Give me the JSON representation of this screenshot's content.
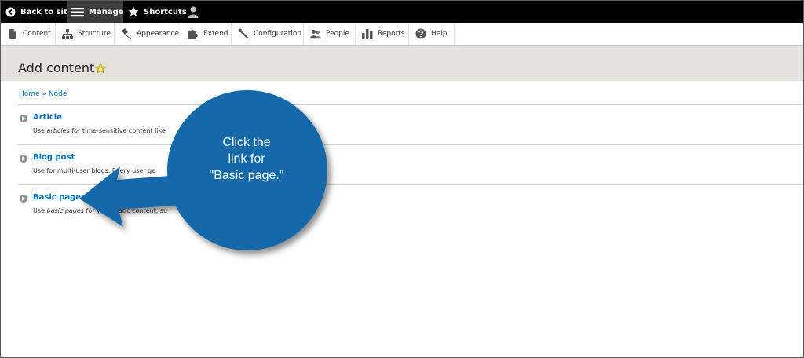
{
  "admin_bar": {
    "back_label": "Back to site",
    "manage_label": "Manage",
    "shortcuts_label": "Shortcuts",
    "user_label": ""
  },
  "toolbar": {
    "items": [
      {
        "label": "Content",
        "icon": "document-icon"
      },
      {
        "label": "Structure",
        "icon": "sitemap-icon"
      },
      {
        "label": "Appearance",
        "icon": "brush-icon"
      },
      {
        "label": "Extend",
        "icon": "puzzle-icon"
      },
      {
        "label": "Configuration",
        "icon": "wrench-icon"
      },
      {
        "label": "People",
        "icon": "people-icon"
      },
      {
        "label": "Reports",
        "icon": "bar-chart-icon"
      },
      {
        "label": "Help",
        "icon": "help-icon"
      }
    ]
  },
  "page": {
    "title": "Add content",
    "breadcrumb": {
      "home": "Home",
      "separator": "»",
      "node": "Node"
    }
  },
  "content_types": [
    {
      "title": "Article",
      "desc_prefix": "Use ",
      "desc_em": "articles",
      "desc_suffix": " for time-sensitive content like"
    },
    {
      "title": "Blog post",
      "desc_prefix": "",
      "desc_em": "",
      "desc_suffix": "Use for multi-user blogs. Every user ge"
    },
    {
      "title": "Basic page",
      "desc_prefix": "Use ",
      "desc_em": "basic pages",
      "desc_suffix": " for your static content, su"
    }
  ],
  "callout": {
    "lines": [
      "Click the",
      "link for",
      "\"Basic page.\""
    ],
    "color": "#1569a8"
  },
  "colors": {
    "link": "#0074bd",
    "header_band": "#e3e2dc",
    "admin_bar": "#000000"
  }
}
